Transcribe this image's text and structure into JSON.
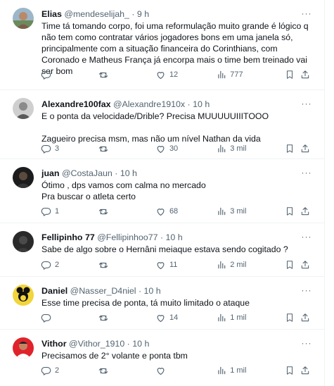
{
  "tweets": [
    {
      "name": "Elias",
      "handle": "@mendeselijah_",
      "time": "9 h",
      "text": "Time tá tomando corpo, foi uma reformulação muito grande é lógico q não tem como contratar vários jogadores bons em uma janela só, principalmente com a situação financeira do Corinthians, com Coronado e Matheus França já encorpa mais o time bem treinado vai ser bom",
      "replies": "",
      "retweets": "",
      "likes": "12",
      "views": "777"
    },
    {
      "name": "Alexandre100fax",
      "handle": "@Alexandre1910x",
      "time": "10 h",
      "text": "E o ponta da velocidade/Drible? Precisa MUUUUUIIITOOO\n\nZagueiro precisa msm, mas não um nível Nathan da vida",
      "replies": "3",
      "retweets": "",
      "likes": "30",
      "views": "3 mil"
    },
    {
      "name": "juan",
      "handle": "@CostaJaun",
      "time": "10 h",
      "text": "Ótimo , dps vamos com calma no mercado\nPra buscar o atleta certo",
      "replies": "1",
      "retweets": "",
      "likes": "68",
      "views": "3 mil"
    },
    {
      "name": "Fellipinho 77",
      "handle": "@Fellipinhoo77",
      "time": "10 h",
      "text": "Sabe de algo sobre o Hernâni meiaque  estava sendo cogitado ?",
      "replies": "2",
      "retweets": "",
      "likes": "11",
      "views": "2 mil"
    },
    {
      "name": "Daniel",
      "handle": "@Nasser_D4niel",
      "time": "10 h",
      "text": "Esse time precisa de ponta, tá muito limitado o ataque",
      "replies": "",
      "retweets": "",
      "likes": "14",
      "views": "1 mil"
    },
    {
      "name": "Vithor",
      "handle": "@Vithor_1910",
      "time": "10 h",
      "text": "Precisamos de 2° volante e ponta tbm",
      "replies": "2",
      "retweets": "",
      "likes": "",
      "views": "1 mil"
    }
  ],
  "separator": "·",
  "more_glyph": "···",
  "colors": {
    "text": "#0f1419",
    "secondary": "#536471",
    "border": "#eff3f4"
  },
  "icons": [
    "reply-icon",
    "retweet-icon",
    "like-icon",
    "views-icon",
    "bookmark-icon",
    "share-icon",
    "more-icon"
  ]
}
